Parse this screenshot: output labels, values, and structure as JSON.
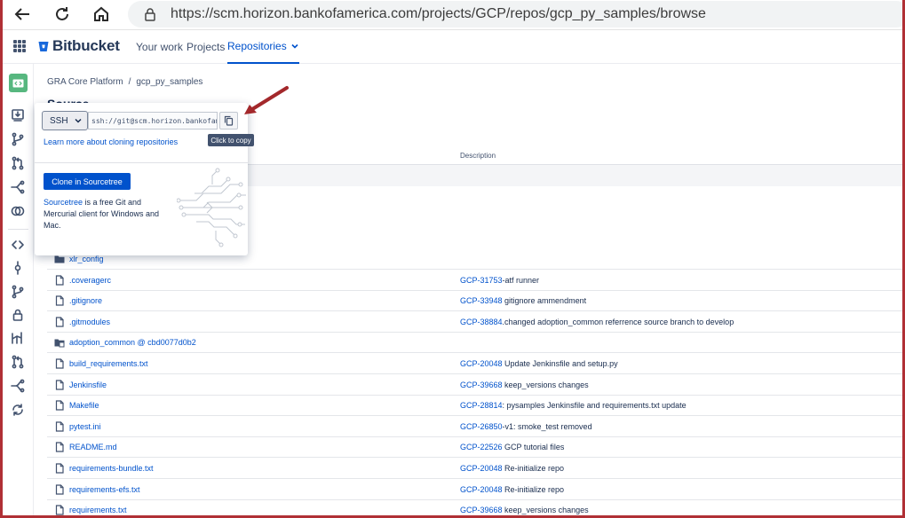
{
  "browser": {
    "url": "https://scm.horizon.bankofamerica.com/projects/GCP/repos/gcp_py_samples/browse"
  },
  "header": {
    "brand": "Bitbucket",
    "nav": [
      {
        "label": "Your work"
      },
      {
        "label": "Projects"
      },
      {
        "label": "Repositories"
      }
    ]
  },
  "breadcrumb": {
    "project": "GRA Core Platform",
    "separator": "/",
    "repo": "gcp_py_samples"
  },
  "page": {
    "title": "Source"
  },
  "clone_popup": {
    "protocol": "SSH",
    "clone_url": "ssh://git@scm.horizon.bankofamer",
    "copy_tooltip": "Click to copy",
    "learn_link": "Learn more about cloning repositories",
    "sourcetree_button": "Clone in Sourcetree",
    "sourcetree_link": "Sourcetree",
    "sourcetree_text": " is a free Git and Mercurial client for Windows and Mac."
  },
  "table": {
    "description_header": "Description",
    "rows": [
      {
        "type": "folder",
        "name": "xlr_config",
        "key": "",
        "desc": ""
      },
      {
        "type": "file",
        "name": ".coveragerc",
        "key": "GCP-31753",
        "desc": "-atf runner"
      },
      {
        "type": "file",
        "name": ".gitignore",
        "key": "GCP-33948",
        "desc": " gitignore ammendment"
      },
      {
        "type": "file",
        "name": ".gitmodules",
        "key": "GCP-38884",
        "desc": ".changed adoption_common referrence source branch to develop"
      },
      {
        "type": "submodule",
        "name": "adoption_common @ cbd0077d0b2",
        "key": "",
        "desc": ""
      },
      {
        "type": "file",
        "name": "build_requirements.txt",
        "key": "GCP-20048",
        "desc": " Update Jenkinsfile and setup.py"
      },
      {
        "type": "file",
        "name": "Jenkinsfile",
        "key": "GCP-39668",
        "desc": " keep_versions changes"
      },
      {
        "type": "file",
        "name": "Makefile",
        "key": "GCP-28814",
        "desc": ": pysamples Jenkinsfile and requirements.txt update"
      },
      {
        "type": "file",
        "name": "pytest.ini",
        "key": "GCP-26850",
        "desc": "-v1: smoke_test removed"
      },
      {
        "type": "file",
        "name": "README.md",
        "key": "GCP-22526",
        "desc": " GCP tutorial files"
      },
      {
        "type": "file",
        "name": "requirements-bundle.txt",
        "key": "GCP-20048",
        "desc": " Re-initialize repo"
      },
      {
        "type": "file",
        "name": "requirements-efs.txt",
        "key": "GCP-20048",
        "desc": " Re-initialize repo"
      },
      {
        "type": "file",
        "name": "requirements.txt",
        "key": "GCP-39668",
        "desc": " keep_versions changes"
      }
    ]
  },
  "colors": {
    "accent": "#0052cc",
    "frame_border": "#b03035",
    "repo_avatar": "#57b77f",
    "annotation_arrow": "#a3282b"
  }
}
